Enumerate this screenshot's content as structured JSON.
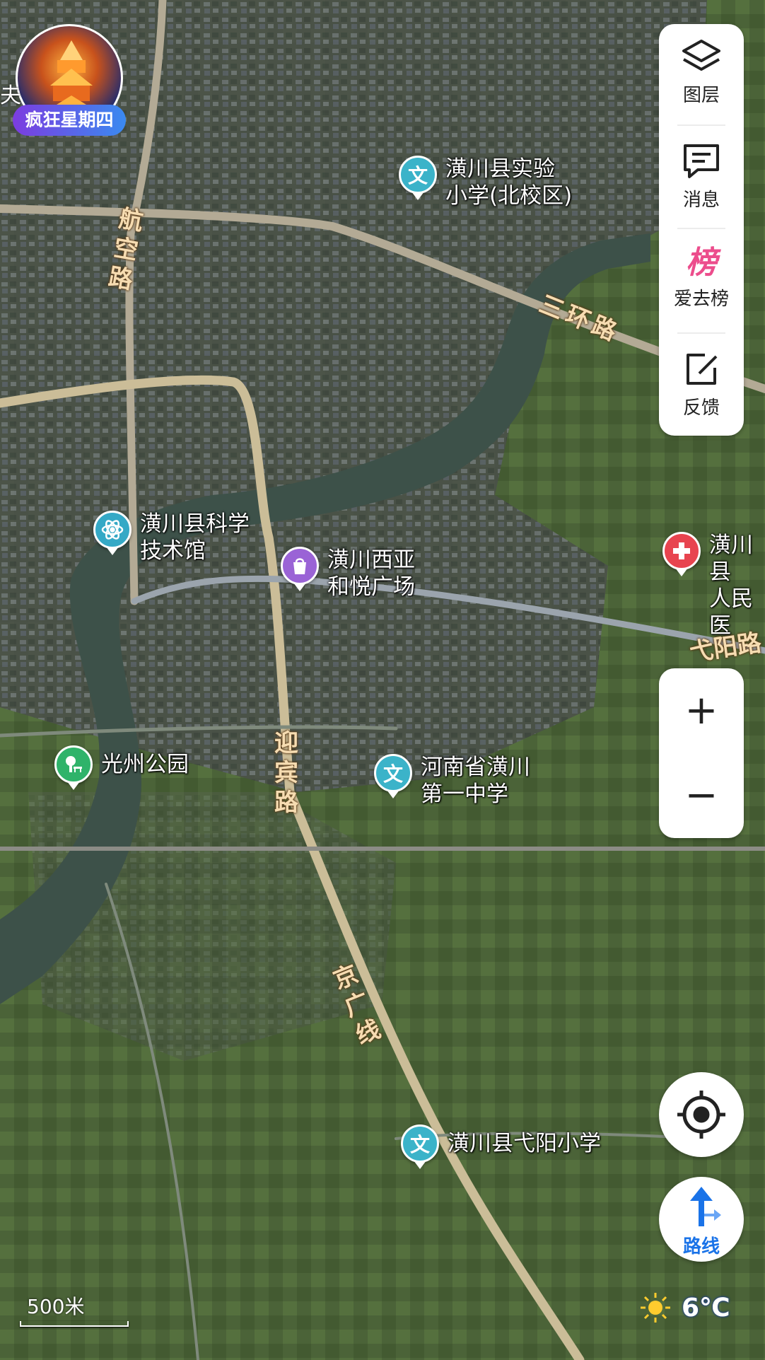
{
  "badge": {
    "label": "疯狂星期四",
    "edge_char": "夫"
  },
  "roads": {
    "hangkong": "航空路",
    "sanhuan": "三环路",
    "yibin": "迎宾路",
    "jingguang": "京广线",
    "yiyang": "弋阳路"
  },
  "pois": {
    "shiyan": {
      "label": "潢川县实验\n小学(北校区)",
      "icon": "wen-icon",
      "glyph": "文"
    },
    "kexue": {
      "label": "潢川县科学\n技术馆",
      "icon": "atom-icon"
    },
    "xiya": {
      "label": "潢川西亚\n和悦广场",
      "icon": "shopping-bag-icon"
    },
    "renmin": {
      "label": "潢川县\n人民医",
      "icon": "hospital-cross-icon"
    },
    "guangzhou": {
      "label": "光州公园",
      "icon": "park-icon"
    },
    "diyi": {
      "label": "河南省潢川\n第一中学",
      "icon": "wen-icon",
      "glyph": "文"
    },
    "yiyang_school": {
      "label": "潢川县弋阳小学",
      "icon": "wen-icon",
      "glyph": "文"
    }
  },
  "toolbar": {
    "layers": {
      "label": "图层",
      "icon": "layers-icon"
    },
    "messages": {
      "label": "消息",
      "icon": "message-icon"
    },
    "ranking": {
      "label": "爱去榜",
      "icon": "ranking-icon",
      "glyph": "榜"
    },
    "feedback": {
      "label": "反馈",
      "icon": "feedback-icon"
    }
  },
  "zoom": {
    "in": "+",
    "out": "−"
  },
  "route": {
    "label": "路线",
    "icon": "route-arrow-icon"
  },
  "scale": {
    "label": "500米"
  },
  "weather": {
    "temp": "6℃",
    "icon": "sun-icon"
  },
  "colors": {
    "school": "#3bb3c9",
    "science": "#35a9c6",
    "mall": "#9a63d6",
    "hospital": "#e8444f",
    "park": "#2fb36a",
    "ranking": "#ec4d8c",
    "route": "#1a73e8"
  }
}
